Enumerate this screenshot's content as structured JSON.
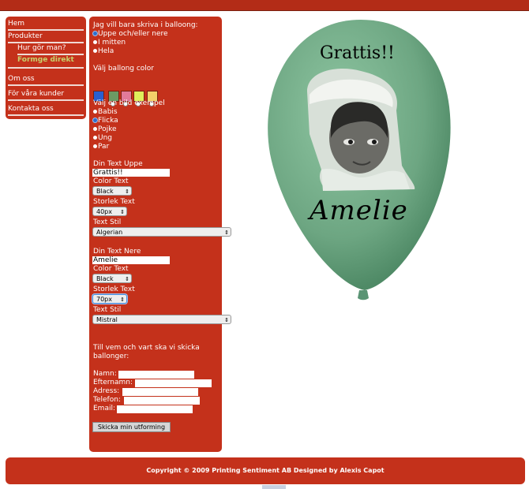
{
  "nav": {
    "items": [
      "Hem",
      "Produkter"
    ],
    "subitems": [
      "Hur gör man?",
      "Formge direkt"
    ],
    "items2": [
      "Om oss",
      "För våra kunder",
      "Kontakta oss"
    ]
  },
  "form": {
    "section1_title": "Jag vill bara skriva i balloong:",
    "write_options": [
      "Uppe och/eller nere",
      "I mitten",
      "Hela"
    ],
    "color_title": "Välj ballong color",
    "swatches": [
      "#2a5fd0",
      "#6c9a64",
      "#e27a9a",
      "#dfee5b",
      "#f4cf6a"
    ],
    "example_title": "Välj en bild exempel",
    "examples": [
      "Babis",
      "Flicka",
      "Pojke",
      "Ung",
      "Par"
    ],
    "top_text_label": "Din Text Uppe",
    "top_text_value": "Grattis!!",
    "color_text_label": "Color Text",
    "top_color": "Black",
    "size_label": "Storlek Text",
    "top_size": "40px",
    "style_label": "Text Stil",
    "top_style": "Algerian",
    "bottom_text_label": "Din Text Nere",
    "bottom_text_value": "Amelie",
    "bottom_color": "Black",
    "bottom_size": "70px",
    "bottom_style": "Mistral",
    "send_question_1": "Till vem och vart ska vi skicka",
    "send_question_2": "ballonger:",
    "fields": [
      "Namn:",
      "Efternamn:",
      "Adress:",
      "Telefon:",
      "Email:"
    ],
    "submit_label": "Skicka min utforming"
  },
  "preview": {
    "top_text": "Grattis!!",
    "bottom_text": "Amelie",
    "balloon_color": "#6da682"
  },
  "footer": {
    "text": "Copyright © 2009 Printing Sentiment AB Designed by Alexis Capot"
  }
}
